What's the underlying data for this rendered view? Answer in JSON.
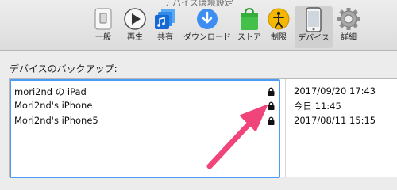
{
  "window": {
    "title": "デバイス環境設定"
  },
  "toolbar": {
    "items": [
      {
        "label": "一般",
        "icon": "general-switch-icon"
      },
      {
        "label": "再生",
        "icon": "playback-icon"
      },
      {
        "label": "共有",
        "icon": "sharing-icon"
      },
      {
        "label": "ダウンロード",
        "icon": "download-icon"
      },
      {
        "label": "ストア",
        "icon": "store-bag-icon"
      },
      {
        "label": "制限",
        "icon": "restrictions-icon"
      },
      {
        "label": "デバイス",
        "icon": "device-icon",
        "selected": true
      },
      {
        "label": "詳細",
        "icon": "advanced-gear-icon"
      }
    ]
  },
  "backups": {
    "label": "デバイスのバックアップ:",
    "rows": [
      {
        "name": "mori2nd の iPad",
        "date": "2017/09/20 17:43",
        "locked": true
      },
      {
        "name": "Mori2nd's iPhone",
        "date": "今日 11:45",
        "locked": true
      },
      {
        "name": "Mori2nd's iPhone5",
        "date": "2017/08/11 15:15",
        "locked": true
      }
    ]
  },
  "colors": {
    "accent": "#4c9bf5",
    "arrow": "#f0457a",
    "selected_tab": "#d0d0d0"
  }
}
